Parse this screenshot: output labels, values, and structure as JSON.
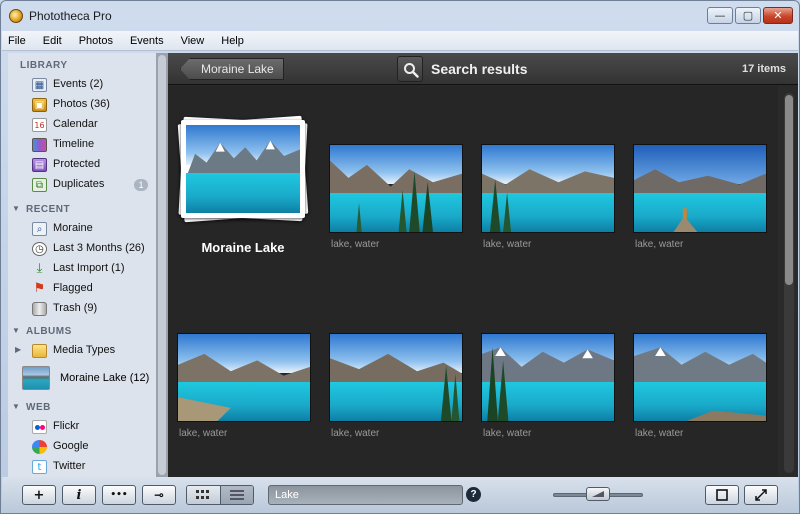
{
  "window": {
    "title": "Phototheca Pro",
    "minimize": "—",
    "maximize": "▢",
    "close": "✕"
  },
  "menu": [
    "File",
    "Edit",
    "Photos",
    "Events",
    "View",
    "Help"
  ],
  "sidebar": {
    "library_header": "LIBRARY",
    "library": [
      {
        "label": "Events (2)",
        "icon": "events-icon"
      },
      {
        "label": "Photos (36)",
        "icon": "photos-icon"
      },
      {
        "label": "Calendar",
        "icon": "calendar-icon"
      },
      {
        "label": "Timeline",
        "icon": "timeline-icon"
      },
      {
        "label": "Protected",
        "icon": "protected-icon"
      },
      {
        "label": "Duplicates",
        "icon": "duplicates-icon",
        "badge": "1"
      }
    ],
    "recent_header": "RECENT",
    "recent": [
      {
        "label": "Moraine",
        "icon": "search-icon"
      },
      {
        "label": "Last 3 Months (26)",
        "icon": "clock-icon"
      },
      {
        "label": "Last Import (1)",
        "icon": "import-icon"
      },
      {
        "label": "Flagged",
        "icon": "flag-icon"
      },
      {
        "label": "Trash (9)",
        "icon": "trash-icon"
      }
    ],
    "albums_header": "ALBUMS",
    "albums": [
      {
        "label": "Media Types",
        "icon": "folder-icon"
      },
      {
        "label": "Moraine Lake (12)",
        "icon": "album-thumbnail"
      }
    ],
    "web_header": "WEB",
    "web": [
      {
        "label": "Flickr",
        "icon": "flickr-icon"
      },
      {
        "label": "Google",
        "icon": "google-icon"
      },
      {
        "label": "Twitter",
        "icon": "twitter-icon"
      }
    ]
  },
  "main": {
    "back_label": "Moraine Lake",
    "title": "Search results",
    "count": "17 items",
    "album_title": "Moraine Lake",
    "tiles": [
      {
        "caption": "lake, water"
      },
      {
        "caption": "lake, water"
      },
      {
        "caption": "lake, water"
      },
      {
        "caption": "lake, water"
      },
      {
        "caption": "lake, water"
      },
      {
        "caption": "lake, water"
      },
      {
        "caption": "lake, water"
      }
    ]
  },
  "toolbar": {
    "add": "+",
    "info": "i",
    "more": "•••",
    "key": "⊸",
    "search_value": "Lake",
    "help": "?"
  },
  "colors": {
    "accent": "#1aa9c9",
    "dark_bg": "#2a2a2a",
    "sidebar_bg": "#dde3ec"
  }
}
